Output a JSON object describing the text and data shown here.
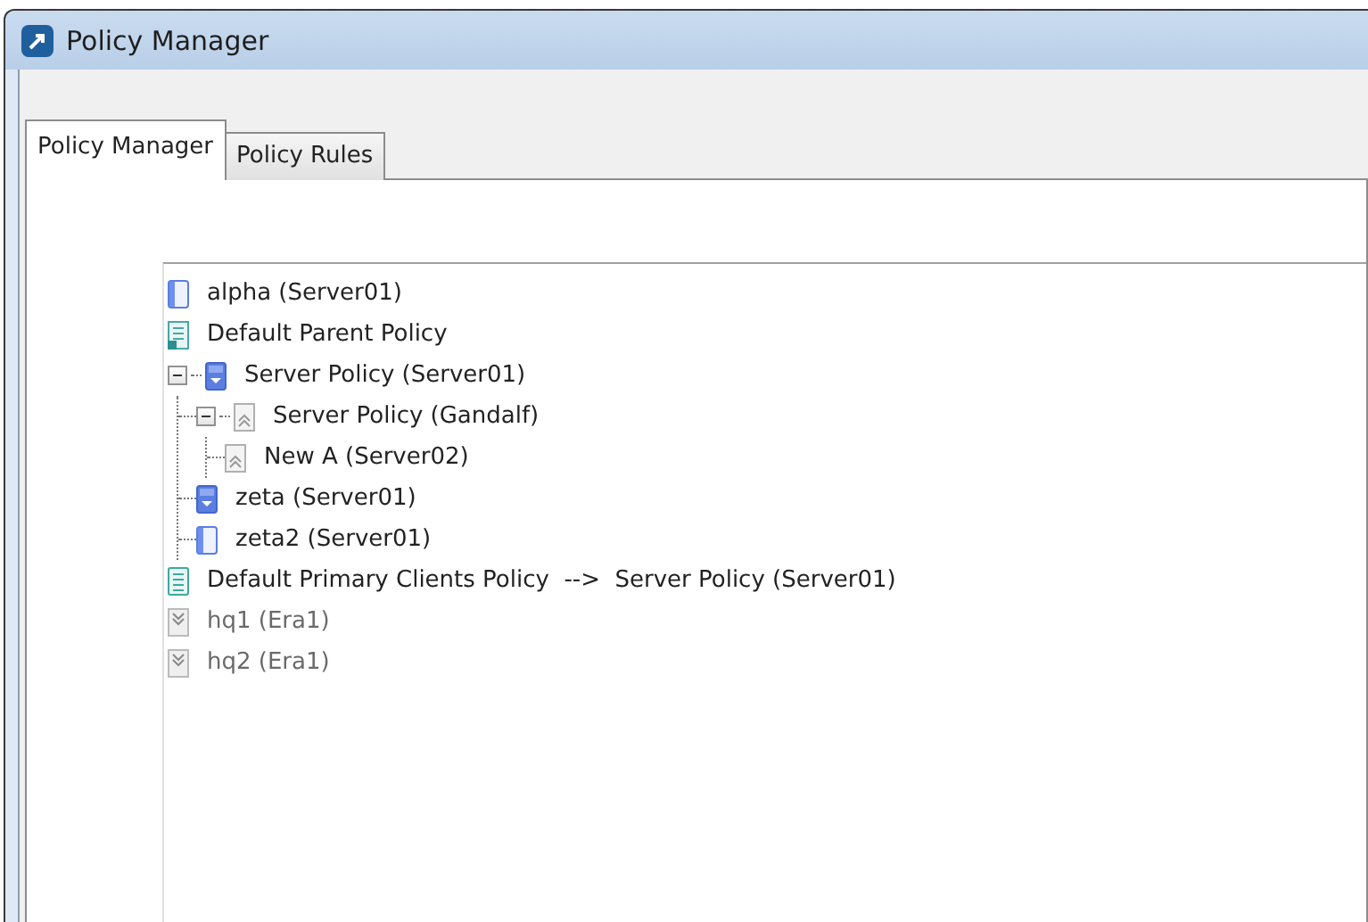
{
  "window": {
    "title": "Policy Manager"
  },
  "tabs": [
    {
      "label": "Policy Manager",
      "selected": true
    },
    {
      "label": "Policy Rules",
      "selected": false
    }
  ],
  "tree": [
    {
      "label": "alpha (Server01)",
      "kind": "blank",
      "dimmed": false
    },
    {
      "label": "Default Parent Policy",
      "kind": "parent",
      "dimmed": false
    },
    {
      "label": "Server Policy (Server01)",
      "kind": "down",
      "dimmed": false,
      "expanded": true,
      "children": [
        {
          "label": "Server Policy (Gandalf)",
          "kind": "up",
          "dimmed": false,
          "expanded": true,
          "children": [
            {
              "label": "New A (Server02)",
              "kind": "up",
              "dimmed": false
            }
          ]
        },
        {
          "label": "zeta (Server01)",
          "kind": "down",
          "dimmed": false
        },
        {
          "label": "zeta2 (Server01)",
          "kind": "blank",
          "dimmed": false
        }
      ]
    },
    {
      "label": "Default Primary Clients Policy  -->  Server Policy (Server01)",
      "kind": "list",
      "dimmed": false
    },
    {
      "label": "hq1 (Era1)",
      "kind": "grey",
      "dimmed": true
    },
    {
      "label": "hq2 (Era1)",
      "kind": "grey",
      "dimmed": true
    }
  ]
}
